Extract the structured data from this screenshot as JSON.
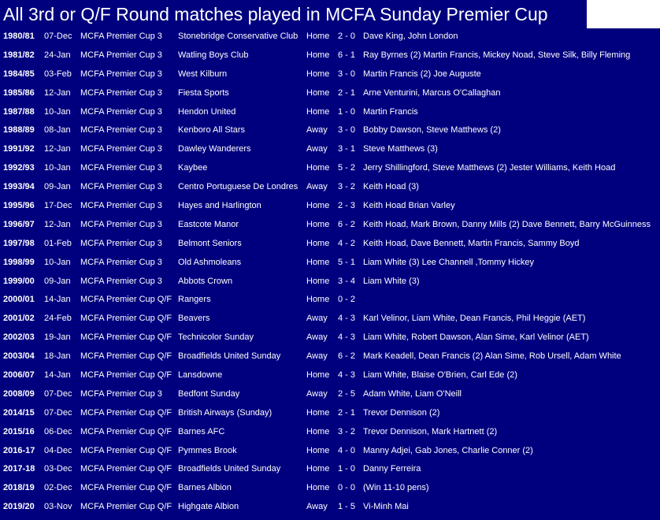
{
  "title": "All 3rd or Q/F Round matches played in MCFA Sunday Premier Cup",
  "colors": {
    "background": "#00007f",
    "text": "#ffffff"
  },
  "matches": [
    {
      "season": "1980/81",
      "date": "07-Dec",
      "competition": "MCFA Premier Cup 3",
      "opponent": "Stonebridge Conservative Club",
      "venue": "Home",
      "score": "2 - 0",
      "scorers": "Dave King, John London"
    },
    {
      "season": "1981/82",
      "date": "24-Jan",
      "competition": "MCFA Premier Cup 3",
      "opponent": "Watling Boys Club",
      "venue": "Home",
      "score": "6 - 1",
      "scorers": "Ray Byrnes (2) Martin Francis, Mickey Noad, Steve Silk, Billy Fleming"
    },
    {
      "season": "1984/85",
      "date": "03-Feb",
      "competition": "MCFA Premier Cup 3",
      "opponent": "West Kilburn",
      "venue": "Home",
      "score": "3 - 0",
      "scorers": "Martin Francis (2) Joe Auguste"
    },
    {
      "season": "1985/86",
      "date": "12-Jan",
      "competition": "MCFA Premier Cup 3",
      "opponent": "Fiesta Sports",
      "venue": "Home",
      "score": "2 - 1",
      "scorers": "Arne Venturini,  Marcus O'Callaghan"
    },
    {
      "season": "1987/88",
      "date": "10-Jan",
      "competition": "MCFA Premier Cup 3",
      "opponent": "Hendon United",
      "venue": "Home",
      "score": "1 - 0",
      "scorers": "Martin Francis"
    },
    {
      "season": "1988/89",
      "date": "08-Jan",
      "competition": "MCFA Premier Cup 3",
      "opponent": "Kenboro All Stars",
      "venue": "Away",
      "score": "3 - 0",
      "scorers": "Bobby Dawson, Steve Matthews (2)"
    },
    {
      "season": "1991/92",
      "date": "12-Jan",
      "competition": "MCFA Premier Cup 3",
      "opponent": "Dawley Wanderers",
      "venue": "Away",
      "score": "3 - 1",
      "scorers": "Steve Matthews (3)"
    },
    {
      "season": "1992/93",
      "date": "10-Jan",
      "competition": "MCFA Premier Cup 3",
      "opponent": "Kaybee",
      "venue": "Home",
      "score": "5 - 2",
      "scorers": "Jerry Shillingford, Steve Matthews (2) Jester Williams, Keith Hoad"
    },
    {
      "season": "1993/94",
      "date": "09-Jan",
      "competition": "MCFA Premier Cup 3",
      "opponent": "Centro Portuguese De Londres",
      "venue": "Away",
      "score": "3 - 2",
      "scorers": "Keith Hoad (3)"
    },
    {
      "season": "1995/96",
      "date": "17-Dec",
      "competition": "MCFA Premier Cup 3",
      "opponent": "Hayes and Harlington",
      "venue": "Home",
      "score": "2 - 3",
      "scorers": "Keith Hoad Brian Varley"
    },
    {
      "season": "1996/97",
      "date": "12-Jan",
      "competition": "MCFA Premier Cup 3",
      "opponent": "Eastcote Manor",
      "venue": "Home",
      "score": "6 - 2",
      "scorers": "Keith Hoad, Mark Brown, Danny Mills (2) Dave Bennett, Barry McGuinness"
    },
    {
      "season": "1997/98",
      "date": "01-Feb",
      "competition": "MCFA Premier Cup 3",
      "opponent": "Belmont Seniors",
      "venue": "Home",
      "score": "4 - 2",
      "scorers": "Keith Hoad, Dave Bennett, Martin Francis, Sammy Boyd"
    },
    {
      "season": "1998/99",
      "date": "10-Jan",
      "competition": "MCFA Premier Cup 3",
      "opponent": "Old Ashmoleans",
      "venue": "Home",
      "score": "5 - 1",
      "scorers": "Liam White (3) Lee Channell ,Tommy Hickey"
    },
    {
      "season": "1999/00",
      "date": "09-Jan",
      "competition": "MCFA Premier Cup 3",
      "opponent": "Abbots Crown",
      "venue": "Home",
      "score": "3 - 4",
      "scorers": "Liam White (3)"
    },
    {
      "season": "2000/01",
      "date": "14-Jan",
      "competition": "MCFA Premier Cup Q/F",
      "opponent": "Rangers",
      "venue": "Home",
      "score": "0 - 2",
      "scorers": ""
    },
    {
      "season": "2001/02",
      "date": "24-Feb",
      "competition": "MCFA Premier Cup Q/F",
      "opponent": "Beavers",
      "venue": "Away",
      "score": "4 - 3",
      "scorers": "Karl Velinor, Liam White, Dean Francis, Phil Heggie (AET)"
    },
    {
      "season": "2002/03",
      "date": "19-Jan",
      "competition": "MCFA Premier Cup Q/F",
      "opponent": "Technicolor Sunday",
      "venue": "Away",
      "score": "4 - 3",
      "scorers": "Liam White, Robert Dawson, Alan Sime, Karl Velinor (AET)"
    },
    {
      "season": "2003/04",
      "date": "18-Jan",
      "competition": "MCFA Premier Cup Q/F",
      "opponent": "Broadfields United Sunday",
      "venue": "Away",
      "score": "6 - 2",
      "scorers": "Mark Keadell, Dean Francis (2) Alan Sime, Rob Ursell, Adam White"
    },
    {
      "season": "2006/07",
      "date": "14-Jan",
      "competition": "MCFA Premier Cup Q/F",
      "opponent": "Lansdowne",
      "venue": "Home",
      "score": "4 - 3",
      "scorers": "Liam White, Blaise O'Brien, Carl Ede (2)"
    },
    {
      "season": "2008/09",
      "date": "07-Dec",
      "competition": "MCFA Premier Cup 3",
      "opponent": "Bedfont Sunday",
      "venue": "Away",
      "score": "2 - 5",
      "scorers": "Adam White, Liam O'Neill"
    },
    {
      "season": "2014/15",
      "date": "07-Dec",
      "competition": "MCFA Premier Cup Q/F",
      "opponent": "British Airways (Sunday)",
      "venue": "Home",
      "score": "2 - 1",
      "scorers": "Trevor Dennison (2)"
    },
    {
      "season": "2015/16",
      "date": "06-Dec",
      "competition": "MCFA Premier Cup Q/F",
      "opponent": "Barnes AFC",
      "venue": "Home",
      "score": "3 - 2",
      "scorers": "Trevor Dennison, Mark Hartnett (2)"
    },
    {
      "season": "2016-17",
      "date": "04-Dec",
      "competition": "MCFA Premier Cup Q/F",
      "opponent": "Pymmes Brook",
      "venue": "Home",
      "score": "4 - 0",
      "scorers": "Manny Adjei, Gab Jones, Charlie Conner (2)"
    },
    {
      "season": "2017-18",
      "date": "03-Dec",
      "competition": "MCFA Premier Cup Q/F",
      "opponent": "Broadfields United Sunday",
      "venue": "Home",
      "score": "1 - 0",
      "scorers": "Danny Ferreira"
    },
    {
      "season": "2018/19",
      "date": "02-Dec",
      "competition": "MCFA Premier Cup Q/F",
      "opponent": "Barnes Albion",
      "venue": "Home",
      "score": "0 - 0",
      "scorers": "(Win 11-10 pens)"
    },
    {
      "season": "2019/20",
      "date": "03-Nov",
      "competition": "MCFA Premier Cup Q/F",
      "opponent": "Highgate Albion",
      "venue": "Away",
      "score": "1 - 5",
      "scorers": "Vi-Minh Mai"
    }
  ]
}
